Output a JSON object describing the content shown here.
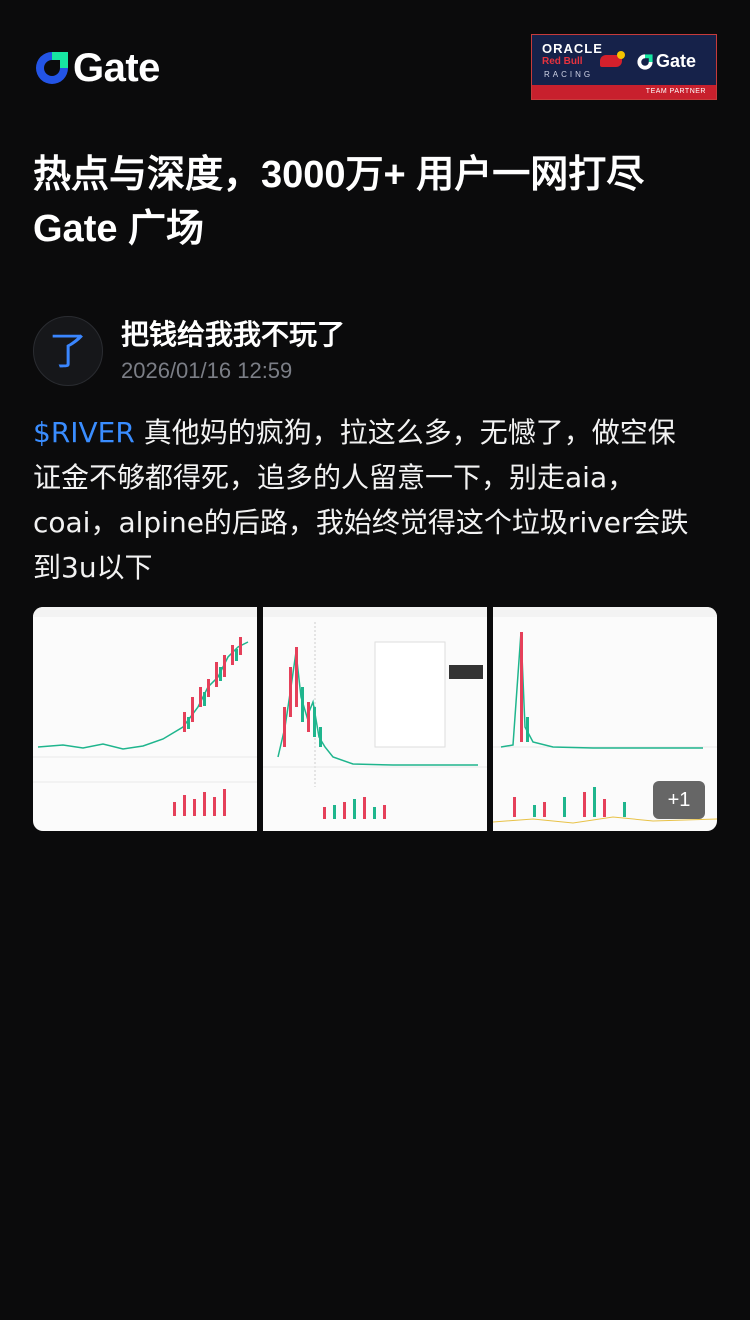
{
  "brand": {
    "logo_text": "Gate",
    "accent": "#2354e6",
    "accent_green": "#17e6a1"
  },
  "partner_banner": {
    "oracle": "ORACLE",
    "redbull": "Red Bull",
    "racing": "RACING",
    "gate": "Gate",
    "team_partner": "TEAM PARTNER"
  },
  "headline": {
    "line1": "热点与深度，3000万+ 用户一网打尽",
    "line2": "Gate 广场"
  },
  "post": {
    "avatar_char": "了",
    "username": "把钱给我我不玩了",
    "timestamp": "2026/01/16 12:59",
    "ticker": "$RIVER",
    "line1_rest": " 真他妈的疯狗，拉这么多，无憾了，做空保",
    "line2": "证金不够都得死，追多的人留意一下，别走aia，",
    "line3": "coai，alpine的后路，我始终觉得这个垃圾river会跌",
    "line4": "到3u以下",
    "more_images_badge": "+1"
  },
  "colors": {
    "background": "#0b0b0c",
    "ticker": "#3a8dff",
    "timestamp": "#7b7e86",
    "up": "#e5405a",
    "down": "#1fb58d"
  }
}
